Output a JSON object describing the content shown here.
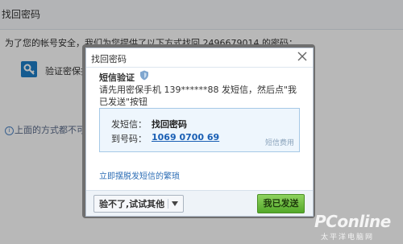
{
  "page": {
    "title": "找回密码",
    "intro": "为了您的帐号安全，我们为您提供了以下方式找回 2496679014 的密码：",
    "method_label": "验证密保找",
    "fallback": "上面的方式都不可用"
  },
  "dialog": {
    "title": "找回密码",
    "section_title": "短信验证",
    "instruction": "请先用密保手机 139******88 发短信，然后点\"我已发送\"按钮",
    "send_label": "发短信：",
    "send_value": "找回密码",
    "to_label": "到号码：",
    "to_value": "1069 0700 69",
    "fee_note": "短信费用",
    "help_link": "立即摆脱发短信的繁琐",
    "try_other_label": "验不了,试试其他",
    "sent_label": "我已发送"
  },
  "watermark": {
    "brand": "PConline",
    "sub": "太平洋电脑网"
  },
  "colors": {
    "link": "#1a5fb4",
    "button_green": "#53a82a",
    "box_bg": "#eef6fd"
  }
}
